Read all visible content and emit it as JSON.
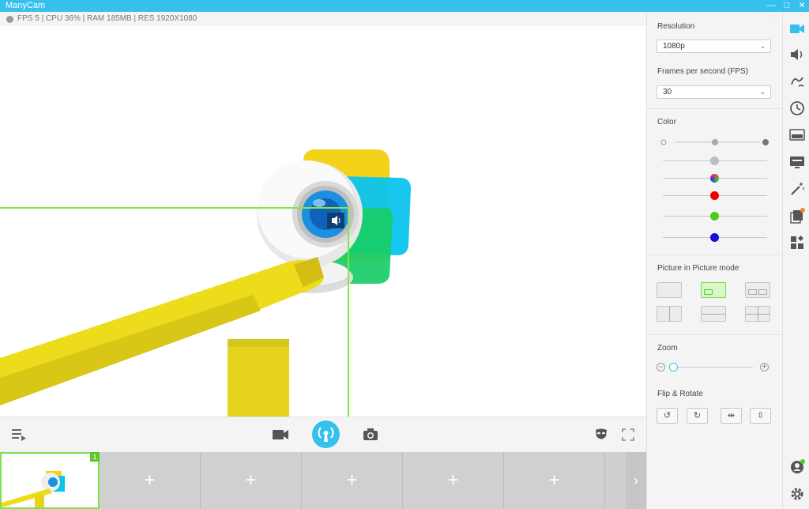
{
  "window": {
    "title": "ManyCam",
    "minimize_icon": "minimize-icon",
    "maximize_icon": "maximize-icon",
    "close_icon": "close-icon"
  },
  "status": {
    "stats": "FPS 5 | CPU 36% | RAM 185MB | RES 1920X1080"
  },
  "video": {
    "volume_icon": "speaker-icon",
    "colors": {
      "green_guide": "#7fe74a",
      "yellow": "#f0da1f",
      "cyan": "#08c9f0",
      "green": "#1fd06a"
    }
  },
  "controls": {
    "playlist_icon": "playlist-icon",
    "record_icon": "video-camera-icon",
    "broadcast_icon": "broadcast-icon",
    "snapshot_icon": "camera-icon",
    "mask_icon": "mask-icon",
    "fullscreen_icon": "fullscreen-icon",
    "accent": "#36c0ee"
  },
  "presets": {
    "active_badge": "1",
    "add_label": "+",
    "next_label": "›"
  },
  "panel": {
    "resolution_label": "Resolution",
    "resolution_value": "1080p",
    "fps_label": "Frames per second (FPS)",
    "fps_value": "30",
    "color_label": "Color",
    "pip_label": "Picture in Picture mode",
    "zoom_label": "Zoom",
    "zoom_minus": "−",
    "zoom_plus": "+",
    "flip_label": "Flip & Rotate",
    "flip_buttons": [
      "↺",
      "↻",
      "⇹",
      "⇳"
    ],
    "color_sliders": {
      "brightness": 0.5,
      "contrast": 0.5,
      "saturation": 0.5,
      "red": 0.5,
      "green": 0.5,
      "blue": 0.5
    },
    "zoom_level": 0.0
  },
  "rail": {
    "items": [
      "video-camera-icon",
      "volume-icon",
      "draw-icon",
      "clock-icon",
      "lower-third-icon",
      "presentation-icon",
      "magic-wand-icon",
      "layers-icon",
      "widgets-icon"
    ],
    "bottom": [
      "account-icon",
      "settings-icon"
    ]
  }
}
